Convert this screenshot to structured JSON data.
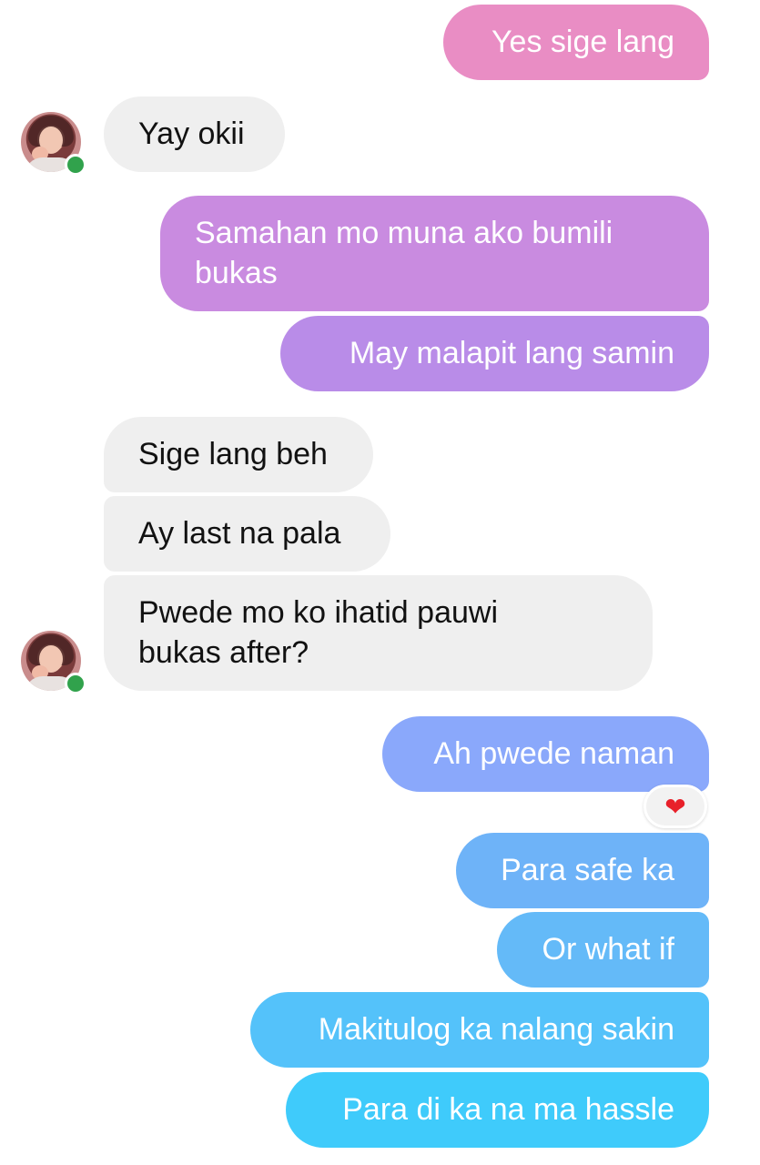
{
  "messages": [
    {
      "text": "Yes sige lang",
      "side": "sent",
      "color": "#e98dc4"
    },
    {
      "text": "Yay okii",
      "side": "received",
      "color": "#efefef"
    },
    {
      "text": "Samahan mo muna ako bumili\nbukas",
      "side": "sent",
      "color": "#c98be0"
    },
    {
      "text": "May malapit lang samin",
      "side": "sent",
      "color": "#b98ce8"
    },
    {
      "text": "Sige lang beh",
      "side": "received",
      "color": "#efefef"
    },
    {
      "text": "Ay last na pala",
      "side": "received",
      "color": "#efefef"
    },
    {
      "text": "Pwede mo ko ihatid pauwi\nbukas after?",
      "side": "received",
      "color": "#efefef"
    },
    {
      "text": "Ah pwede naman",
      "side": "sent",
      "color": "#8aa8fb",
      "reaction": "heart-icon"
    },
    {
      "text": "Para safe ka",
      "side": "sent",
      "color": "#6eb3f8"
    },
    {
      "text": "Or what if",
      "side": "sent",
      "color": "#64baf8"
    },
    {
      "text": "Makitulog ka nalang sakin",
      "side": "sent",
      "color": "#54c2fa"
    },
    {
      "text": "Para di ka na ma hassle",
      "side": "sent",
      "color": "#3fcbfb"
    }
  ],
  "contact": {
    "avatar_icon": "profile-avatar",
    "status": "online",
    "status_color": "#31a24c"
  },
  "reaction_glyph": "❤"
}
